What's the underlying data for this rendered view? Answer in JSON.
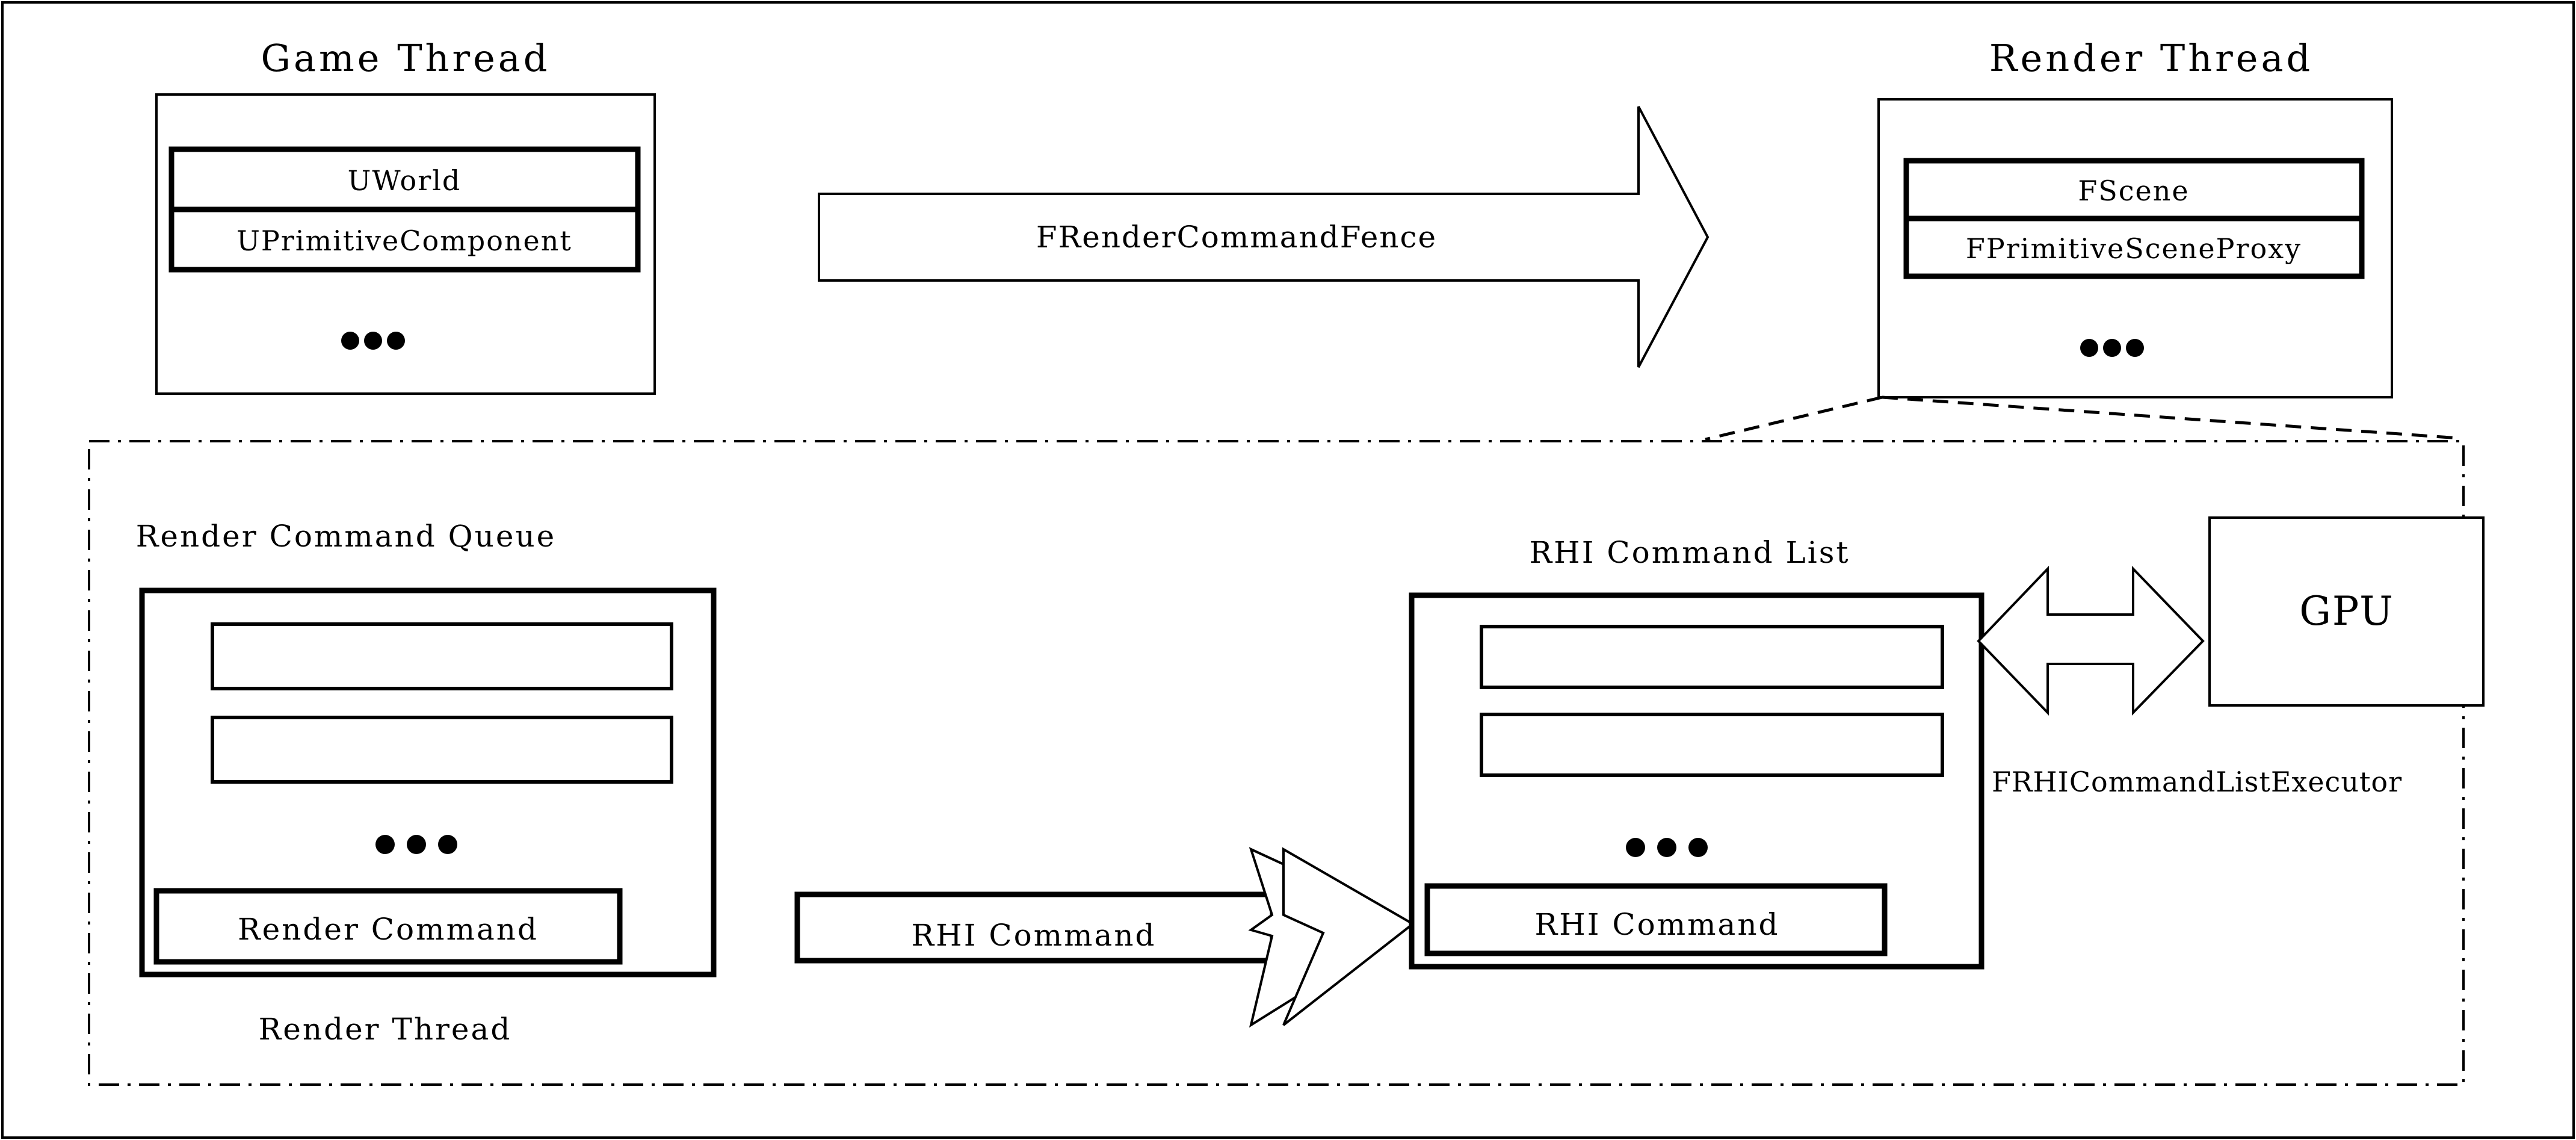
{
  "diagram": {
    "title_game_thread": "Game Thread",
    "title_render_thread": "Render Thread",
    "game_thread": {
      "items": [
        {
          "label": "UWorld"
        },
        {
          "label": "UPrimitiveComponent"
        }
      ],
      "ellipsis": "• • •"
    },
    "render_thread": {
      "items": [
        {
          "label": "FScene"
        },
        {
          "label": "FPrimitiveSceneProxy"
        }
      ],
      "ellipsis": "• • •"
    },
    "fence_arrow_label": "FRenderCommandFence",
    "detail_panel": {
      "render_command_queue_title": "Render Command Queue",
      "render_command_queue_items": [
        {
          "label": ""
        },
        {
          "label": ""
        },
        {
          "label": "Render Command"
        }
      ],
      "render_command_queue_ellipsis": "• • •",
      "render_thread_footer": "Render Thread",
      "rhi_command_box_label": "RHI Command",
      "rhi_command_list_title": "RHI Command List",
      "rhi_command_list_items": [
        {
          "label": ""
        },
        {
          "label": ""
        },
        {
          "label": "RHI Command"
        }
      ],
      "rhi_command_list_ellipsis": "• • •",
      "gpu_label": "GPU",
      "executor_label": "FRHICommandListExecutor"
    },
    "colors": {
      "stroke": "#000000",
      "background": "#ffffff"
    }
  }
}
